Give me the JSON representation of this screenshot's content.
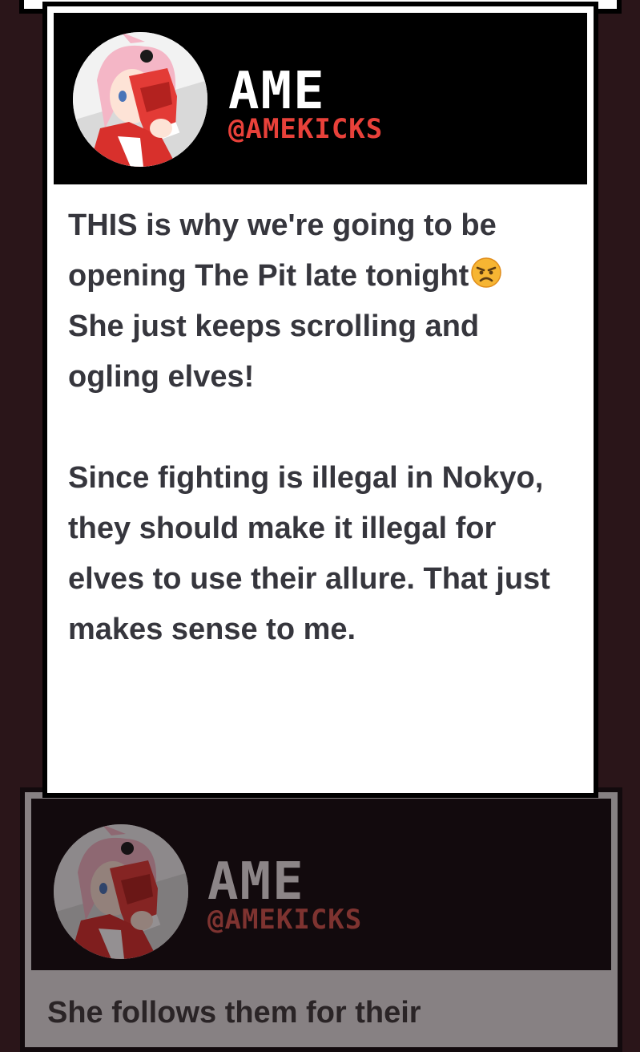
{
  "colors": {
    "background": "#2a1519",
    "card": "#ffffff",
    "card_border": "#000000",
    "header_bg": "#000000",
    "name": "#ffffff",
    "handle": "#e8413a",
    "body_text": "#36363d",
    "dim_card": "#878183"
  },
  "post": {
    "author_name": "AME",
    "author_handle": "@AMEKICKS",
    "avatar_icon": "avatar-ame",
    "paragraph1": "THIS is why we're going to be opening The Pit late tonight",
    "emoji": "😠",
    "emoji_icon": "angry-face-emoji",
    "paragraph1_cont": "She just keeps scrolling and ogling elves!",
    "paragraph2": "Since fighting is illegal in Nokyo, they should make it illegal for elves to use their allure. That just makes sense to me."
  },
  "next_post": {
    "author_name": "AME",
    "author_handle": "@AMEKICKS",
    "avatar_icon": "avatar-ame",
    "text": "She follows them for their"
  }
}
